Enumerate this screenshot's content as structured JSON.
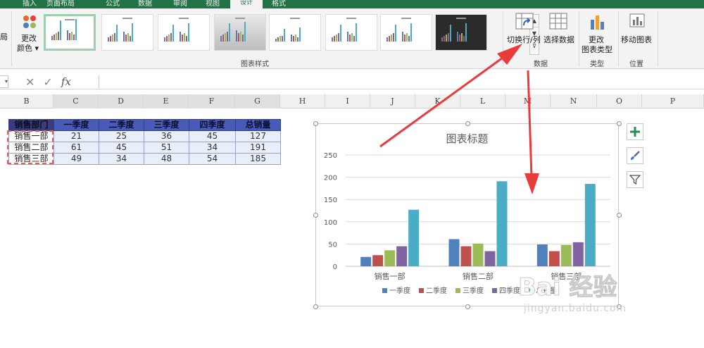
{
  "ribbon": {
    "tabs": [
      {
        "label": "插入",
        "active": false
      },
      {
        "label": "页面布局",
        "active": false
      },
      {
        "label": "公式",
        "active": false
      },
      {
        "label": "数据",
        "active": false
      },
      {
        "label": "审阅",
        "active": false
      },
      {
        "label": "视图",
        "active": false
      },
      {
        "label": "设计",
        "active": true
      },
      {
        "label": "格式",
        "active": false
      }
    ],
    "layout_partial": "局",
    "change_colors": "更改颜色",
    "change_colors_line1": "更改",
    "change_colors_line2": "颜色 ▾",
    "chart_styles_label": "图表样式",
    "switch_row_col": "切换行/列",
    "select_data": "选择数据",
    "data_group_label": "数据",
    "change_chart_type_line1": "更改",
    "change_chart_type_line2": "图表类型",
    "type_group_label": "类型",
    "move_chart": "移动图表",
    "location_group_label": "位置",
    "gallery_scroll": "▲\n▼\n⊽"
  },
  "formula_bar": {
    "cancel_icon": "✕",
    "enter_icon": "✓",
    "fx_label": "fx",
    "value": ""
  },
  "columns": [
    "B",
    "C",
    "D",
    "E",
    "F",
    "G",
    "H",
    "I",
    "J",
    "K",
    "L",
    "M",
    "N",
    "O",
    "P"
  ],
  "table": {
    "headers": [
      "销售部门",
      "一季度",
      "二季度",
      "三季度",
      "四季度",
      "总销量"
    ],
    "rows": [
      {
        "name": "销售一部",
        "values": [
          "21",
          "25",
          "36",
          "45",
          "127"
        ]
      },
      {
        "name": "销售二部",
        "values": [
          "61",
          "45",
          "51",
          "34",
          "191"
        ]
      },
      {
        "name": "销售三部",
        "values": [
          "49",
          "34",
          "48",
          "54",
          "185"
        ]
      }
    ]
  },
  "chart_data": {
    "type": "bar",
    "title": "图表标题",
    "categories": [
      "销售一部",
      "销售二部",
      "销售三部"
    ],
    "series": [
      {
        "name": "一季度",
        "color": "#4f81bd",
        "values": [
          21,
          61,
          49
        ]
      },
      {
        "name": "二季度",
        "color": "#c0504d",
        "values": [
          25,
          45,
          34
        ]
      },
      {
        "name": "三季度",
        "color": "#9bbb59",
        "values": [
          36,
          51,
          48
        ]
      },
      {
        "name": "四季度",
        "color": "#8064a2",
        "values": [
          45,
          34,
          54
        ]
      },
      {
        "name": "总销量",
        "color": "#4bacc6",
        "values": [
          127,
          191,
          185
        ]
      }
    ],
    "yticks": [
      0,
      50,
      100,
      150,
      200,
      250
    ],
    "ylim": [
      0,
      250
    ],
    "xlabel": "",
    "ylabel": "",
    "grid": true,
    "legend": "bottom"
  },
  "chart_buttons": [
    {
      "name": "add-chart-element",
      "glyph": "+"
    },
    {
      "name": "chart-styles-brush",
      "glyph": "brush"
    },
    {
      "name": "chart-filters",
      "glyph": "filter"
    }
  ],
  "watermark": {
    "main": "Bai 经验",
    "url": "jingyan.baidu.com"
  },
  "colors": {
    "excel_green": "#217346",
    "annotation_red": "#e83b3b",
    "table_header": "#4a5ab8"
  }
}
